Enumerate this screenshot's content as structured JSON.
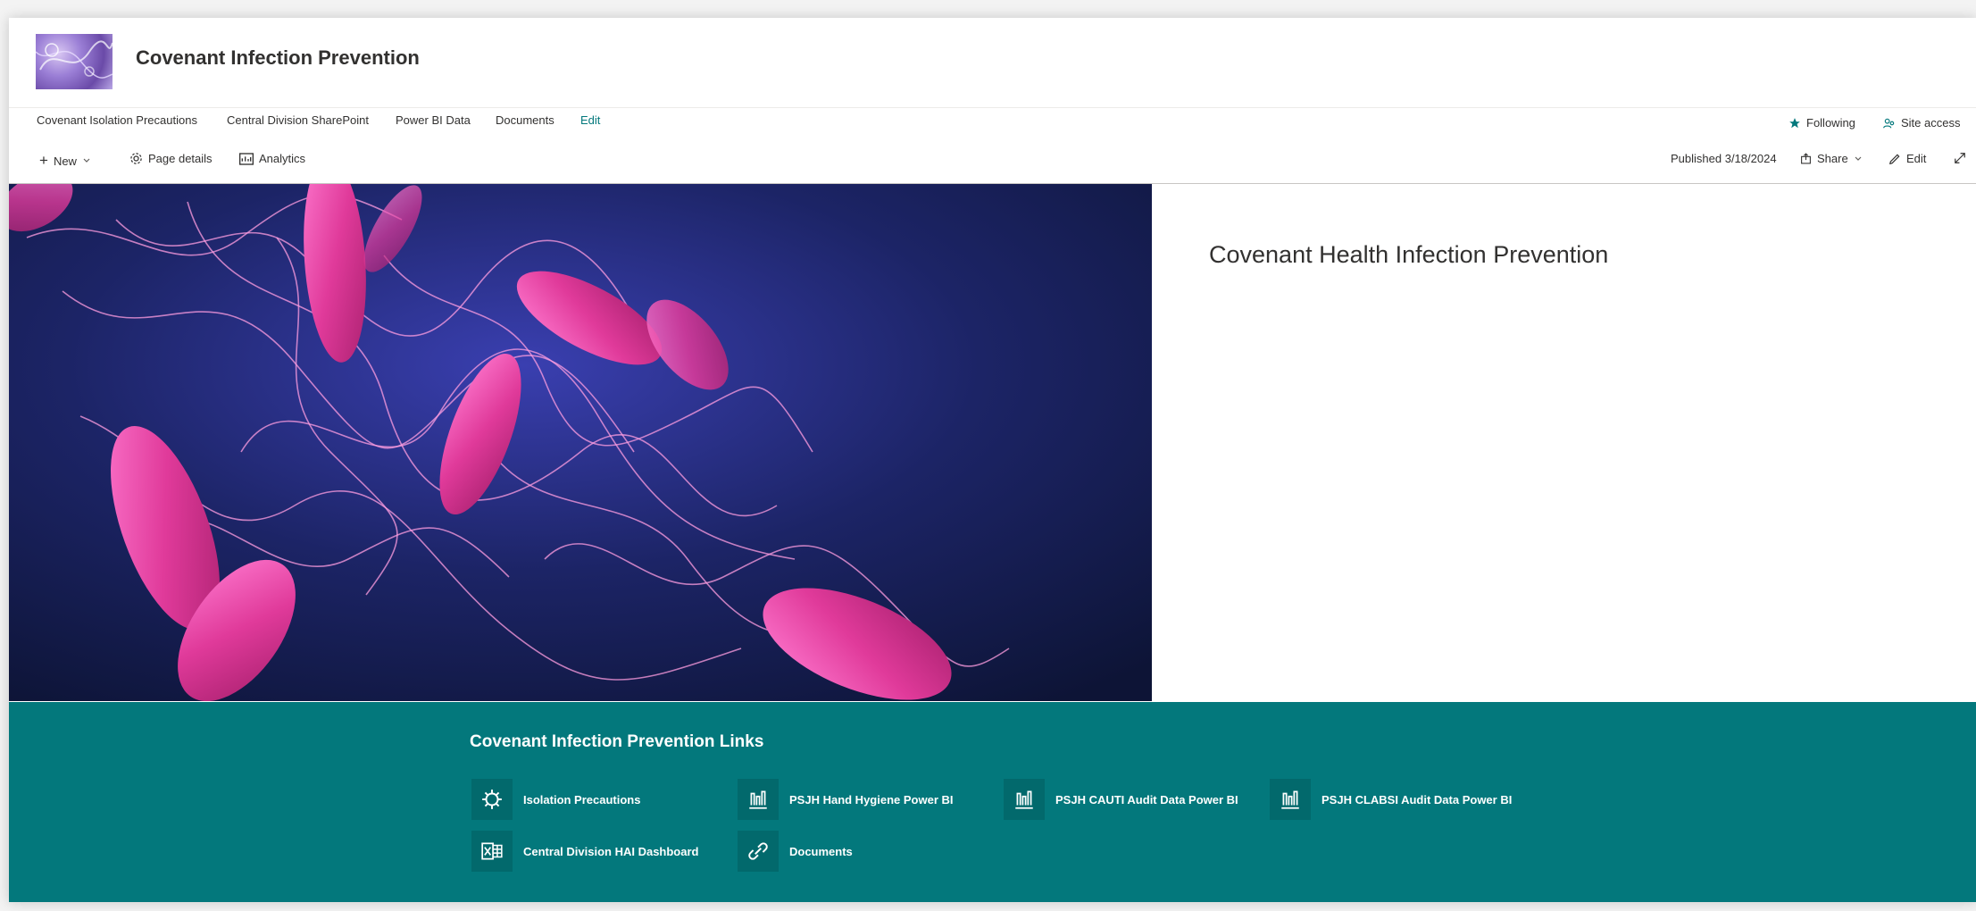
{
  "site": {
    "title": "Covenant Infection Prevention"
  },
  "nav": {
    "items": [
      {
        "label": "Covenant Isolation Precautions"
      },
      {
        "label": "Central Division SharePoint"
      },
      {
        "label": "Power BI Data"
      },
      {
        "label": "Documents"
      }
    ],
    "edit_label": "Edit",
    "following_label": "Following",
    "site_access_label": "Site access"
  },
  "commandbar": {
    "new_label": "New",
    "page_details_label": "Page details",
    "analytics_label": "Analytics",
    "published_label": "Published 3/18/2024",
    "share_label": "Share",
    "edit_label": "Edit"
  },
  "hero": {
    "title": "Covenant Health Infection Prevention"
  },
  "quick_links": {
    "title": "Covenant Infection Prevention Links",
    "items": [
      {
        "label": "Isolation Precautions",
        "icon": "virus-icon"
      },
      {
        "label": "PSJH Hand Hygiene Power BI",
        "icon": "bar-chart-icon"
      },
      {
        "label": "PSJH CAUTI Audit Data Power BI",
        "icon": "bar-chart-icon"
      },
      {
        "label": "PSJH CLABSI Audit Data Power BI",
        "icon": "bar-chart-icon"
      },
      {
        "label": "Central Division HAI Dashboard",
        "icon": "excel-icon"
      },
      {
        "label": "Documents",
        "icon": "link-icon"
      }
    ]
  },
  "colors": {
    "accent": "#03787c",
    "text": "#323130"
  }
}
